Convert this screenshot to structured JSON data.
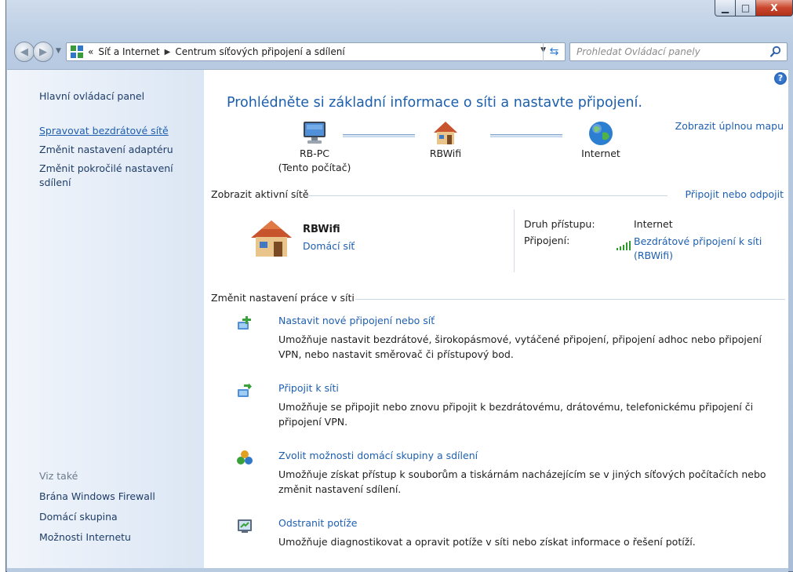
{
  "window": {
    "minimize_glyph": "▁",
    "maximize_glyph": "□",
    "close_glyph": "X"
  },
  "address": {
    "crumbs": [
      "Síť a Internet",
      "Centrum síťových připojení a sdílení"
    ],
    "overflow_glyph": "«"
  },
  "search": {
    "placeholder": "Prohledat Ovládací panely"
  },
  "sidebar": {
    "home": "Hlavní ovládací panel",
    "links": [
      "Spravovat bezdrátové sítě",
      "Změnit nastavení adaptéru",
      "Změnit pokročilé nastavení sdílení"
    ],
    "see_also_title": "Viz také",
    "see_also": [
      "Brána Windows Firewall",
      "Domácí skupina",
      "Možnosti Internetu"
    ]
  },
  "main": {
    "help_glyph": "?",
    "title": "Prohlédněte si základní informace o síti a nastavte připojení.",
    "full_map_link": "Zobrazit úplnou mapu",
    "map_nodes": [
      {
        "label": "RB-PC",
        "sublabel": "(Tento počítač)"
      },
      {
        "label": "RBWifi"
      },
      {
        "label": "Internet"
      }
    ],
    "active_networks_title": "Zobrazit aktivní sítě",
    "connect_link": "Připojit nebo odpojit",
    "network": {
      "name": "RBWifi",
      "type": "Domácí síť",
      "access_label": "Druh přístupu:",
      "access_value": "Internet",
      "connection_label": "Připojení:",
      "connection_value_line1": "Bezdrátové připojení k síti",
      "connection_value_line2": "(RBWifi)"
    },
    "change_settings_title": "Změnit nastavení práce v síti",
    "tasks": [
      {
        "icon": "new-connection-icon",
        "title": "Nastavit nové připojení nebo síť",
        "desc": "Umožňuje nastavit bezdrátové, širokopásmové, vytáčené připojení, připojení adhoc nebo připojení VPN, nebo nastavit směrovač či přístupový bod."
      },
      {
        "icon": "connect-network-icon",
        "title": "Připojit k síti",
        "desc": "Umožňuje se připojit nebo znovu připojit k bezdrátovému, drátovému, telefonickému připojení či připojení VPN."
      },
      {
        "icon": "homegroup-icon",
        "title": "Zvolit možnosti domácí skupiny a sdílení",
        "desc": "Umožňuje získat přístup k souborům a tiskárnám nacházejícím se v jiných síťových počítačích nebo změnit nastavení sdílení."
      },
      {
        "icon": "troubleshoot-icon",
        "title": "Odstranit potíže",
        "desc": "Umožňuje diagnostikovat a opravit potíže v síti nebo získat informace o řešení potíží."
      }
    ]
  }
}
